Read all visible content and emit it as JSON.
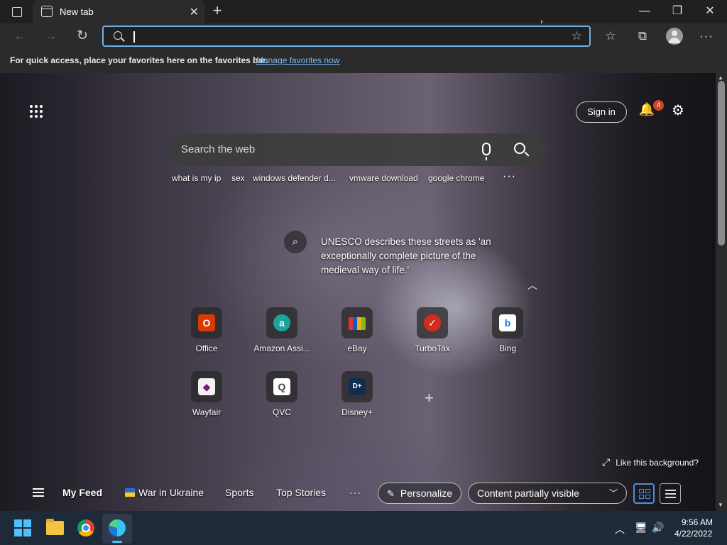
{
  "browser": {
    "tab_title": "New tab",
    "address_value": "",
    "favorites_bar": {
      "message": "For quick access, place your favorites here on the favorites bar.",
      "link": "Manage favorites now"
    }
  },
  "newtab": {
    "sign_in": "Sign in",
    "notifications_count": "4",
    "search_placeholder": "Search the web",
    "trending": [
      "what is my ip",
      "sex",
      "windows defender d...",
      "vmware download",
      "google chrome"
    ],
    "info_text": "UNESCO describes these streets as 'an exceptionally complete picture of the medieval way of life.'",
    "tiles": [
      {
        "label": "Office",
        "glyph": "O",
        "color": "#d83b01"
      },
      {
        "label": "Amazon Assi...",
        "glyph": "a",
        "color": "#1ba39c"
      },
      {
        "label": "eBay",
        "glyph": "",
        "color": "#333333"
      },
      {
        "label": "TurboTax",
        "glyph": "✓",
        "color": "#d52b1e"
      },
      {
        "label": "Bing",
        "glyph": "b",
        "color": "#ffffff"
      },
      {
        "label": "Wayfair",
        "glyph": "◆",
        "color": "#7f187f"
      },
      {
        "label": "QVC",
        "glyph": "Q",
        "color": "#ffffff"
      },
      {
        "label": "Disney+",
        "glyph": "D+",
        "color": "#112e51"
      }
    ],
    "like_background": "Like this background?",
    "feed": {
      "my_feed": "My Feed",
      "items": [
        "War in Ukraine",
        "Sports",
        "Top Stories"
      ],
      "personalize": "Personalize",
      "content_visibility": "Content partially visible"
    }
  },
  "taskbar": {
    "time": "9:56 AM",
    "date": "4/22/2022"
  },
  "colors": {
    "accent": "#4c8fd9",
    "omnibox_focus": "#6fb0e8",
    "badge": "#d04427",
    "taskbar": "#1f2a38"
  }
}
